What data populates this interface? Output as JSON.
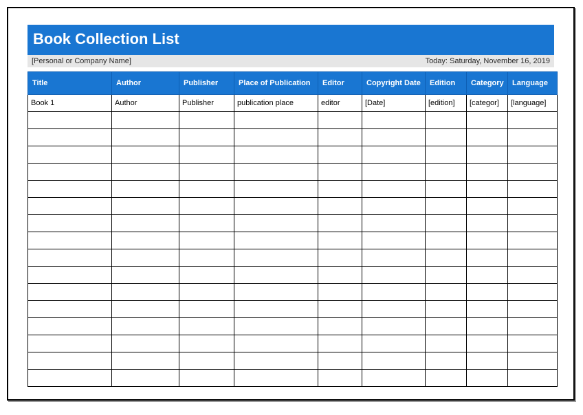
{
  "header": {
    "title": "Book Collection List",
    "owner": "[Personal or Company Name]",
    "today_label": "Today:",
    "today_value": "Saturday, November 16, 2019"
  },
  "table": {
    "columns": [
      "Title",
      "Author",
      "Publisher",
      "Place of Publication",
      "Editor",
      "Copyright Date",
      "Edition",
      "Category",
      "Language"
    ],
    "rows": [
      {
        "title": "Book 1",
        "author": "Author",
        "publisher": "Publisher",
        "place": "publication place",
        "editor": "editor",
        "copyright_date": "[Date]",
        "edition": "[edition]",
        "category": "[categor]",
        "language": "[language]"
      },
      {
        "title": "",
        "author": "",
        "publisher": "",
        "place": "",
        "editor": "",
        "copyright_date": "",
        "edition": "",
        "category": "",
        "language": ""
      },
      {
        "title": "",
        "author": "",
        "publisher": "",
        "place": "",
        "editor": "",
        "copyright_date": "",
        "edition": "",
        "category": "",
        "language": ""
      },
      {
        "title": "",
        "author": "",
        "publisher": "",
        "place": "",
        "editor": "",
        "copyright_date": "",
        "edition": "",
        "category": "",
        "language": ""
      },
      {
        "title": "",
        "author": "",
        "publisher": "",
        "place": "",
        "editor": "",
        "copyright_date": "",
        "edition": "",
        "category": "",
        "language": ""
      },
      {
        "title": "",
        "author": "",
        "publisher": "",
        "place": "",
        "editor": "",
        "copyright_date": "",
        "edition": "",
        "category": "",
        "language": ""
      },
      {
        "title": "",
        "author": "",
        "publisher": "",
        "place": "",
        "editor": "",
        "copyright_date": "",
        "edition": "",
        "category": "",
        "language": ""
      },
      {
        "title": "",
        "author": "",
        "publisher": "",
        "place": "",
        "editor": "",
        "copyright_date": "",
        "edition": "",
        "category": "",
        "language": ""
      },
      {
        "title": "",
        "author": "",
        "publisher": "",
        "place": "",
        "editor": "",
        "copyright_date": "",
        "edition": "",
        "category": "",
        "language": ""
      },
      {
        "title": "",
        "author": "",
        "publisher": "",
        "place": "",
        "editor": "",
        "copyright_date": "",
        "edition": "",
        "category": "",
        "language": ""
      },
      {
        "title": "",
        "author": "",
        "publisher": "",
        "place": "",
        "editor": "",
        "copyright_date": "",
        "edition": "",
        "category": "",
        "language": ""
      },
      {
        "title": "",
        "author": "",
        "publisher": "",
        "place": "",
        "editor": "",
        "copyright_date": "",
        "edition": "",
        "category": "",
        "language": ""
      },
      {
        "title": "",
        "author": "",
        "publisher": "",
        "place": "",
        "editor": "",
        "copyright_date": "",
        "edition": "",
        "category": "",
        "language": ""
      },
      {
        "title": "",
        "author": "",
        "publisher": "",
        "place": "",
        "editor": "",
        "copyright_date": "",
        "edition": "",
        "category": "",
        "language": ""
      },
      {
        "title": "",
        "author": "",
        "publisher": "",
        "place": "",
        "editor": "",
        "copyright_date": "",
        "edition": "",
        "category": "",
        "language": ""
      },
      {
        "title": "",
        "author": "",
        "publisher": "",
        "place": "",
        "editor": "",
        "copyright_date": "",
        "edition": "",
        "category": "",
        "language": ""
      },
      {
        "title": "",
        "author": "",
        "publisher": "",
        "place": "",
        "editor": "",
        "copyright_date": "",
        "edition": "",
        "category": "",
        "language": ""
      }
    ]
  }
}
